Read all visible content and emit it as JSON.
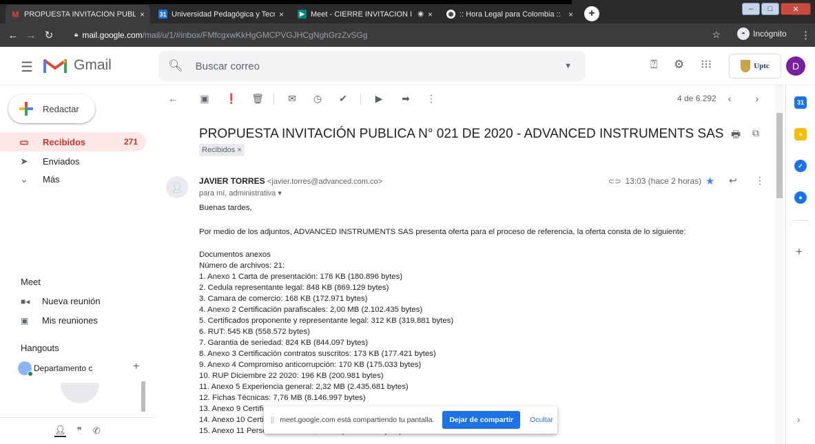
{
  "browser": {
    "tabs": [
      {
        "title": "PROPUESTA INVITACIÓN PUBLIC",
        "favicon": "gmail-icon",
        "close": "×"
      },
      {
        "title": "Universidad Pedagógica y Tecnol",
        "favicon": "calendar-icon",
        "close": "×"
      },
      {
        "title": "Meet - CIERRE INVITACION I",
        "favicon": "meet-icon",
        "close": "×"
      },
      {
        "title": ":: Hora Legal para Colombia ::",
        "favicon": "globe-icon",
        "close": "×"
      }
    ],
    "new_tab": "+",
    "url_host": "mail.google.com",
    "url_path": "/mail/u/1/#inbox/FMfcgxwKkHgGMCPVGJHCgNghGrzZvSGg",
    "incognito_label": "Incógnito"
  },
  "header": {
    "app_name": "Gmail",
    "search_placeholder": "Buscar correo",
    "org_logo_text": "Uptc",
    "avatar_initial": "D",
    "avatar_color": "#7b1fa2"
  },
  "sidebar": {
    "compose_label": "Redactar",
    "nav": [
      {
        "label": "Recibidos",
        "count": "271",
        "icon": "inbox-icon"
      },
      {
        "label": "Enviados",
        "count": "",
        "icon": "send-icon"
      },
      {
        "label": "Más",
        "count": "",
        "icon": "chevron-down-icon"
      }
    ],
    "meet_title": "Meet",
    "meet_items": [
      {
        "label": "Nueva reunión",
        "icon": "video-icon"
      },
      {
        "label": "Mis reuniones",
        "icon": "calendar-icon"
      }
    ],
    "hangouts_title": "Hangouts",
    "hangout_user": "Departamento c"
  },
  "toolbar": {
    "pager": "4 de 6.292"
  },
  "message": {
    "subject": "PROPUESTA INVITACIÓN PUBLICA N° 021 DE 2020 - ADVANCED INSTRUMENTS SAS",
    "label_chip": "Recibidos ×",
    "sender_name": "JAVIER TORRES",
    "sender_email": "<javier.torres@advanced.com.co>",
    "recipients": "para mí, administrativa ▾",
    "time": "13:03 (hace 2 horas)",
    "greeting": "Buenas tardes,",
    "intro": "Por medio de los adjuntos, ADVANCED INSTRUMENTS SAS presenta oferta para el proceso de referencia, la oferta consta de lo siguiente:",
    "docs_title": "Documentos anexos",
    "files_count": "Número de archivos: 21:",
    "items": [
      "1. Anexo 1 Carta de presentación: 176 KB (180.896 bytes)",
      "2. Cedula representante legal: 848 KB (869.129 bytes)",
      "3. Camara de comercio: 168 KB (172.971 bytes)",
      "4. Anexo 2 Certificación parafiscales: 2,00 MB (2.102.435 bytes)",
      "5. Certificados proponente y representante legal: 312 KB (319.881 bytes)",
      "6. RUT: 545 KB (558.572 bytes)",
      "7. Garantia de seriedad: 824 KB (844.097 bytes)",
      "8. Anexo 3 Certificación contratos suscritos: 173 KB (177.421 bytes)",
      "9. Anexo 4 Compromiso anticorrupción: 170 KB (175.033 bytes)",
      "10. RUP Diciembre 22 2020: 196 KB (200.981 bytes)",
      "11. Anexo 5 Experiencia general: 2,32 MB (2.435.681 bytes)",
      "12. Fichas Técnicas: 7,76 MB (8.146.997 bytes)",
      "13. Anexo 9 Certific",
      "14. Anexo 10 Certif",
      "15. Anexo 11 Personal mínimo: 3,63 MB (3.813.311 bytes)"
    ]
  },
  "share_bar": {
    "message": "meet.google.com está compartiendo tu pantalla.",
    "stop_label": "Dejar de compartir",
    "hide_label": "Ocultar"
  }
}
